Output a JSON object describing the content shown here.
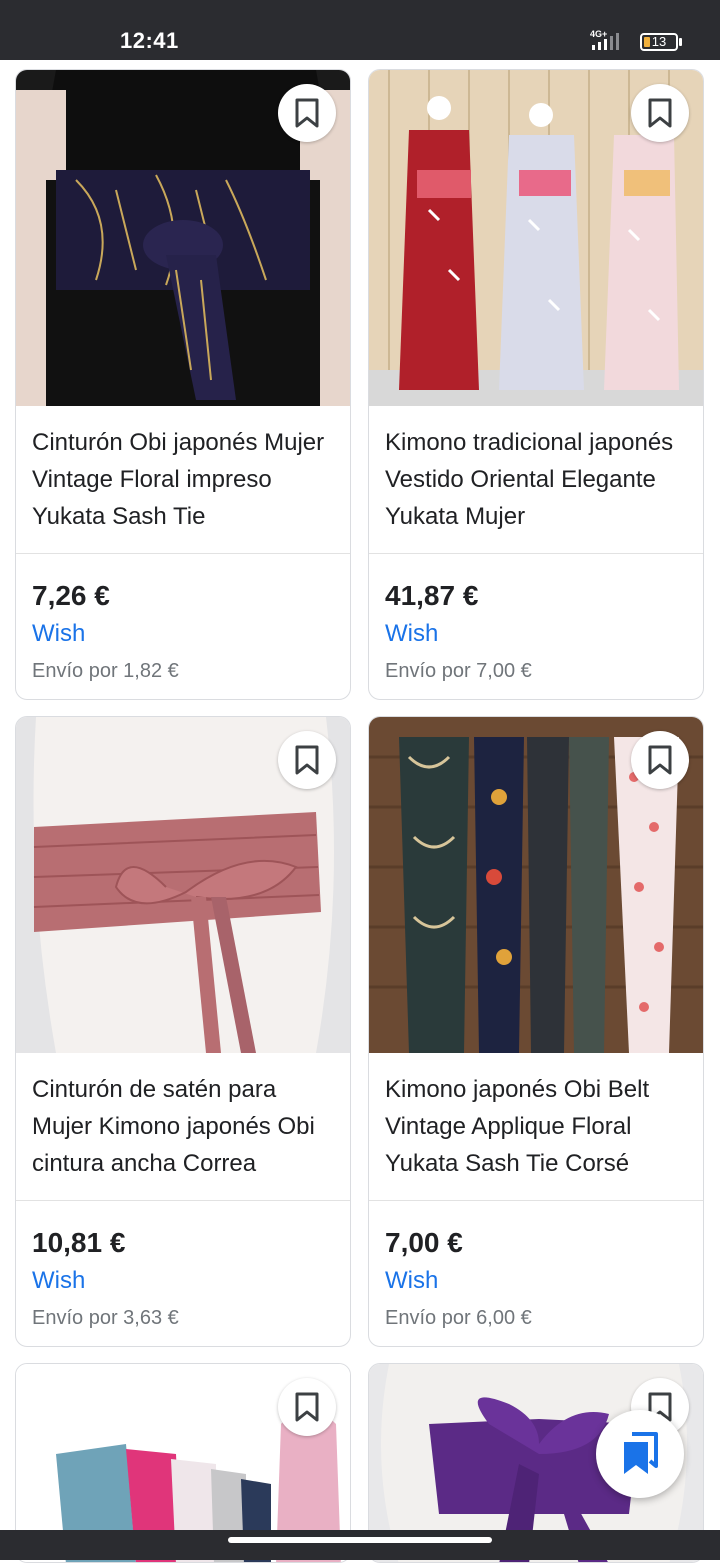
{
  "status_bar": {
    "time": "12:41",
    "network": "4G+",
    "battery": "13"
  },
  "products": [
    {
      "title": "Cinturón Obi japonés Mujer Vintage Floral impreso Yukata Sash Tie",
      "price": "7,26 €",
      "merchant": "Wish",
      "shipping": "Envío por 1,82 €"
    },
    {
      "title": "Kimono tradicional japonés Vestido Oriental Elegante Yukata Mujer",
      "price": "41,87 €",
      "merchant": "Wish",
      "shipping": "Envío por 7,00 €"
    },
    {
      "title": "Cinturón de satén para Mujer Kimono japonés Obi cintura ancha Correa",
      "price": "10,81 €",
      "merchant": "Wish",
      "shipping": "Envío por 3,63 €"
    },
    {
      "title": "Kimono japonés Obi Belt Vintage Applique Floral Yukata Sash Tie Corsé",
      "price": "7,00 €",
      "merchant": "Wish",
      "shipping": "Envío por 6,00 €"
    }
  ],
  "colors": {
    "merchant_link": "#1a73e8",
    "fab_icon": "#1a73e8",
    "status_bar": "#2b2c30"
  },
  "icons": {
    "bookmark": "bookmark-outline-icon",
    "fab": "saved-collections-icon"
  }
}
